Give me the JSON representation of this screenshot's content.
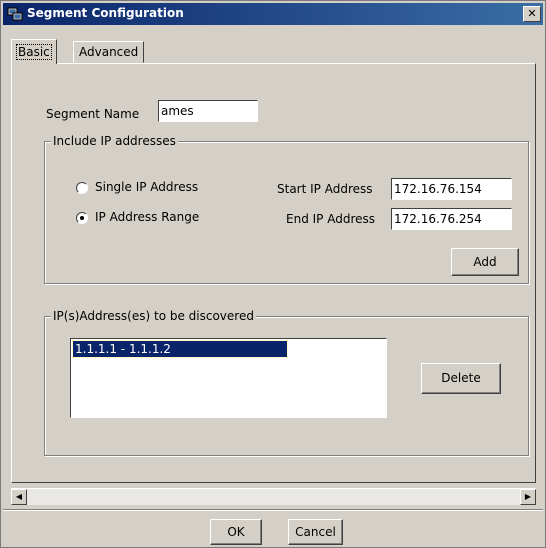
{
  "window": {
    "title": "Segment Configuration",
    "app_icon": "network-app-icon",
    "close_glyph": "✕"
  },
  "tabs": [
    {
      "label": "Basic",
      "active": true
    },
    {
      "label": "Advanced",
      "active": false
    }
  ],
  "segment": {
    "name_label": "Segment Name",
    "name_value": "ames"
  },
  "include_group": {
    "title": "Include IP addresses",
    "single_ip_label": "Single IP  Address",
    "range_label": "IP  Address Range",
    "selected": "range",
    "start_label": "Start  IP Address",
    "start_value": "172.16.76.154",
    "end_label": "End IP Address",
    "end_value": "172.16.76.254",
    "add_label": "Add"
  },
  "discover_group": {
    "title": "IP(s)Address(es) to be discovered",
    "items": [
      "1.1.1.1 - 1.1.1.2"
    ],
    "delete_label": "Delete"
  },
  "footer": {
    "ok_label": "OK",
    "cancel_label": "Cancel"
  },
  "colors": {
    "face": "#d4d0c8",
    "titlebar": "#0a246a",
    "selection": "#0a246a"
  }
}
